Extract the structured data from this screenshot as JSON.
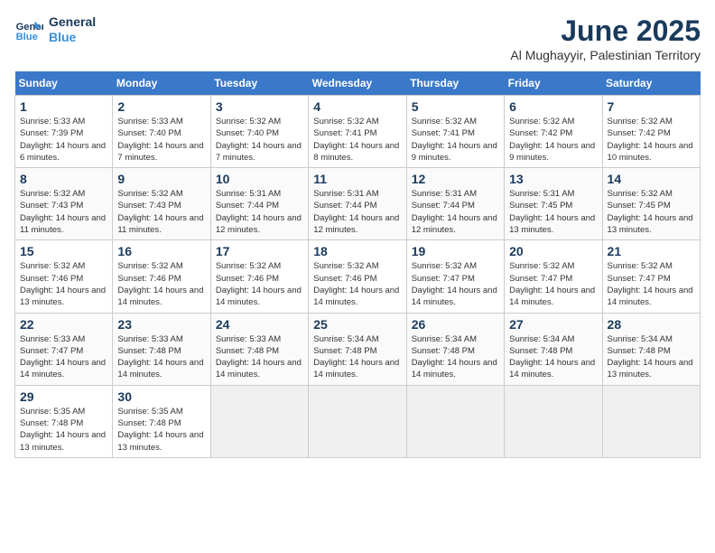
{
  "logo": {
    "line1": "General",
    "line2": "Blue"
  },
  "title": "June 2025",
  "subtitle": "Al Mughayyir, Palestinian Territory",
  "days_header": [
    "Sunday",
    "Monday",
    "Tuesday",
    "Wednesday",
    "Thursday",
    "Friday",
    "Saturday"
  ],
  "weeks": [
    [
      {
        "day": "1",
        "sunrise": "5:33 AM",
        "sunset": "7:39 PM",
        "daylight": "14 hours and 6 minutes."
      },
      {
        "day": "2",
        "sunrise": "5:33 AM",
        "sunset": "7:40 PM",
        "daylight": "14 hours and 7 minutes."
      },
      {
        "day": "3",
        "sunrise": "5:32 AM",
        "sunset": "7:40 PM",
        "daylight": "14 hours and 7 minutes."
      },
      {
        "day": "4",
        "sunrise": "5:32 AM",
        "sunset": "7:41 PM",
        "daylight": "14 hours and 8 minutes."
      },
      {
        "day": "5",
        "sunrise": "5:32 AM",
        "sunset": "7:41 PM",
        "daylight": "14 hours and 9 minutes."
      },
      {
        "day": "6",
        "sunrise": "5:32 AM",
        "sunset": "7:42 PM",
        "daylight": "14 hours and 9 minutes."
      },
      {
        "day": "7",
        "sunrise": "5:32 AM",
        "sunset": "7:42 PM",
        "daylight": "14 hours and 10 minutes."
      }
    ],
    [
      {
        "day": "8",
        "sunrise": "5:32 AM",
        "sunset": "7:43 PM",
        "daylight": "14 hours and 11 minutes."
      },
      {
        "day": "9",
        "sunrise": "5:32 AM",
        "sunset": "7:43 PM",
        "daylight": "14 hours and 11 minutes."
      },
      {
        "day": "10",
        "sunrise": "5:31 AM",
        "sunset": "7:44 PM",
        "daylight": "14 hours and 12 minutes."
      },
      {
        "day": "11",
        "sunrise": "5:31 AM",
        "sunset": "7:44 PM",
        "daylight": "14 hours and 12 minutes."
      },
      {
        "day": "12",
        "sunrise": "5:31 AM",
        "sunset": "7:44 PM",
        "daylight": "14 hours and 12 minutes."
      },
      {
        "day": "13",
        "sunrise": "5:31 AM",
        "sunset": "7:45 PM",
        "daylight": "14 hours and 13 minutes."
      },
      {
        "day": "14",
        "sunrise": "5:32 AM",
        "sunset": "7:45 PM",
        "daylight": "14 hours and 13 minutes."
      }
    ],
    [
      {
        "day": "15",
        "sunrise": "5:32 AM",
        "sunset": "7:46 PM",
        "daylight": "14 hours and 13 minutes."
      },
      {
        "day": "16",
        "sunrise": "5:32 AM",
        "sunset": "7:46 PM",
        "daylight": "14 hours and 14 minutes."
      },
      {
        "day": "17",
        "sunrise": "5:32 AM",
        "sunset": "7:46 PM",
        "daylight": "14 hours and 14 minutes."
      },
      {
        "day": "18",
        "sunrise": "5:32 AM",
        "sunset": "7:46 PM",
        "daylight": "14 hours and 14 minutes."
      },
      {
        "day": "19",
        "sunrise": "5:32 AM",
        "sunset": "7:47 PM",
        "daylight": "14 hours and 14 minutes."
      },
      {
        "day": "20",
        "sunrise": "5:32 AM",
        "sunset": "7:47 PM",
        "daylight": "14 hours and 14 minutes."
      },
      {
        "day": "21",
        "sunrise": "5:32 AM",
        "sunset": "7:47 PM",
        "daylight": "14 hours and 14 minutes."
      }
    ],
    [
      {
        "day": "22",
        "sunrise": "5:33 AM",
        "sunset": "7:47 PM",
        "daylight": "14 hours and 14 minutes."
      },
      {
        "day": "23",
        "sunrise": "5:33 AM",
        "sunset": "7:48 PM",
        "daylight": "14 hours and 14 minutes."
      },
      {
        "day": "24",
        "sunrise": "5:33 AM",
        "sunset": "7:48 PM",
        "daylight": "14 hours and 14 minutes."
      },
      {
        "day": "25",
        "sunrise": "5:34 AM",
        "sunset": "7:48 PM",
        "daylight": "14 hours and 14 minutes."
      },
      {
        "day": "26",
        "sunrise": "5:34 AM",
        "sunset": "7:48 PM",
        "daylight": "14 hours and 14 minutes."
      },
      {
        "day": "27",
        "sunrise": "5:34 AM",
        "sunset": "7:48 PM",
        "daylight": "14 hours and 14 minutes."
      },
      {
        "day": "28",
        "sunrise": "5:34 AM",
        "sunset": "7:48 PM",
        "daylight": "14 hours and 13 minutes."
      }
    ],
    [
      {
        "day": "29",
        "sunrise": "5:35 AM",
        "sunset": "7:48 PM",
        "daylight": "14 hours and 13 minutes."
      },
      {
        "day": "30",
        "sunrise": "5:35 AM",
        "sunset": "7:48 PM",
        "daylight": "14 hours and 13 minutes."
      },
      null,
      null,
      null,
      null,
      null
    ]
  ]
}
